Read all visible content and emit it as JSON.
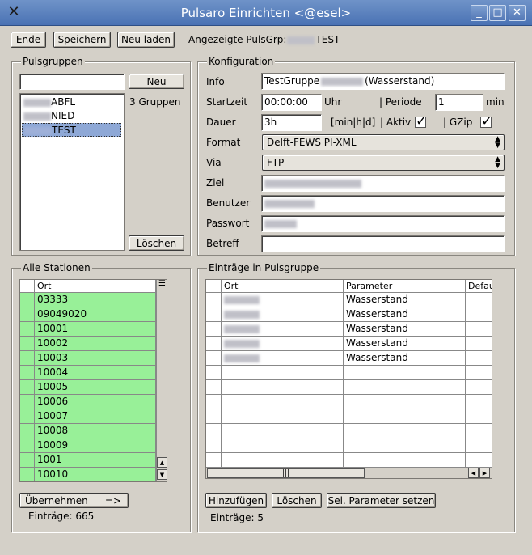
{
  "window": {
    "title": "Pulsaro Einrichten <@esel>"
  },
  "toolbar": {
    "ende": "Ende",
    "speichern": "Speichern",
    "neu_laden": "Neu laden",
    "group_prefix": "Angezeigte PulsGrp:",
    "group_suffix": "TEST"
  },
  "pulsgruppen": {
    "legend": "Pulsgruppen",
    "search_value": "",
    "neu": "Neu",
    "count": "3 Gruppen",
    "items": [
      {
        "suffix": "ABFL"
      },
      {
        "suffix": "NIED"
      },
      {
        "suffix": "TEST"
      }
    ],
    "loeschen": "Löschen"
  },
  "konfig": {
    "legend": "Konfiguration",
    "info_label": "Info",
    "info_prefix": "TestGruppe",
    "info_suffix": "(Wasserstand)",
    "startzeit_label": "Startzeit",
    "startzeit_value": "00:00:00",
    "uhr": "Uhr",
    "periode_label": "| Periode",
    "periode_value": "1",
    "min": "min",
    "dauer_label": "Dauer",
    "dauer_value": "3h",
    "dauer_unit": "[min|h|d]",
    "aktiv_label": "| Aktiv",
    "gzip_label": "| GZip",
    "format_label": "Format",
    "format_value": "Delft-FEWS PI-XML",
    "via_label": "Via",
    "via_value": "FTP",
    "ziel_label": "Ziel",
    "benutzer_label": "Benutzer",
    "passwort_label": "Passwort",
    "betreff_label": "Betreff",
    "betreff_value": ""
  },
  "stationen": {
    "legend": "Alle Stationen",
    "col_ort": "Ort",
    "rows": [
      "03333",
      "09049020",
      "10001",
      "10002",
      "10003",
      "10004",
      "10005",
      "10006",
      "10007",
      "10008",
      "10009",
      "1001",
      "10010"
    ],
    "uebernehmen": "Übernehmen",
    "arrow": "=>",
    "eintraege": "Einträge: 665"
  },
  "eintraege": {
    "legend": "Einträge in Pulsgruppe",
    "col_ort": "Ort",
    "col_parameter": "Parameter",
    "col_default": "Defau",
    "rows": [
      {
        "parameter": "Wasserstand"
      },
      {
        "parameter": "Wasserstand"
      },
      {
        "parameter": "Wasserstand"
      },
      {
        "parameter": "Wasserstand"
      },
      {
        "parameter": "Wasserstand"
      }
    ],
    "hinzufuegen": "Hinzufügen",
    "loeschen": "Löschen",
    "sel_param": "Sel. Parameter setzen",
    "eintraege": "Einträge: 5"
  },
  "icons": {
    "app": "tools-icon",
    "minimize": "minimize-icon",
    "maximize": "maximize-icon",
    "close": "close-icon"
  }
}
